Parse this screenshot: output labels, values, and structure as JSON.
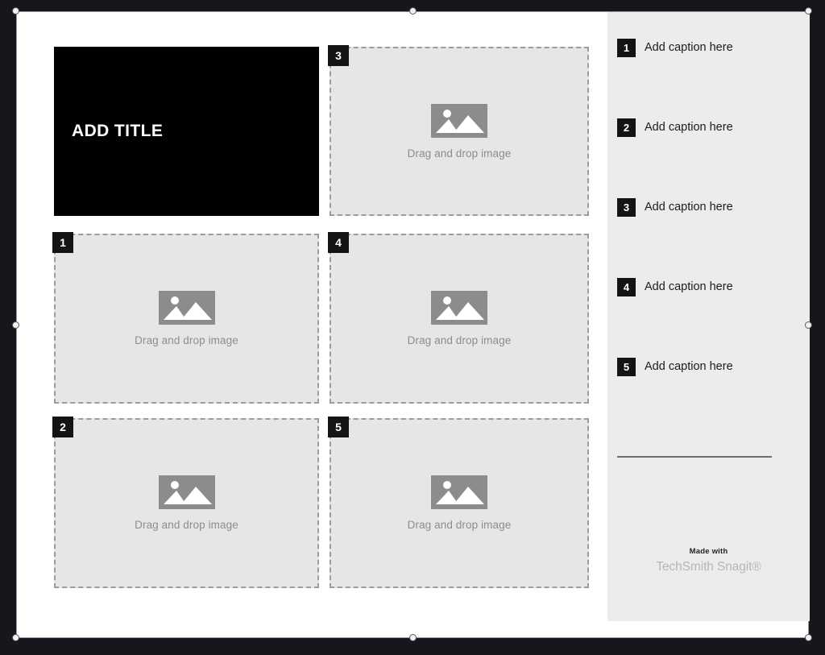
{
  "document": {
    "title_block": {
      "text": "ADD TITLE",
      "background": "#000000",
      "text_color": "#ffffff"
    },
    "placeholders": [
      {
        "number": "3",
        "label": "Drag and drop image",
        "icon": "image-icon"
      },
      {
        "number": "1",
        "label": "Drag and drop image",
        "icon": "image-icon"
      },
      {
        "number": "4",
        "label": "Drag and drop image",
        "icon": "image-icon"
      },
      {
        "number": "2",
        "label": "Drag and drop image",
        "icon": "image-icon"
      },
      {
        "number": "5",
        "label": "Drag and drop image",
        "icon": "image-icon"
      }
    ]
  },
  "sidebar": {
    "background": "#ececec",
    "captions": [
      {
        "number": "1",
        "text": "Add caption here"
      },
      {
        "number": "2",
        "text": "Add caption here"
      },
      {
        "number": "3",
        "text": "Add caption here"
      },
      {
        "number": "4",
        "text": "Add caption here"
      },
      {
        "number": "5",
        "text": "Add caption here"
      }
    ],
    "branding": {
      "made_with": "Made with",
      "product": "TechSmith Snagit®"
    }
  },
  "selection": {
    "handles": [
      "top-left",
      "top-center",
      "top-right",
      "middle-left",
      "middle-right",
      "bottom-left",
      "bottom-center",
      "bottom-right"
    ]
  }
}
